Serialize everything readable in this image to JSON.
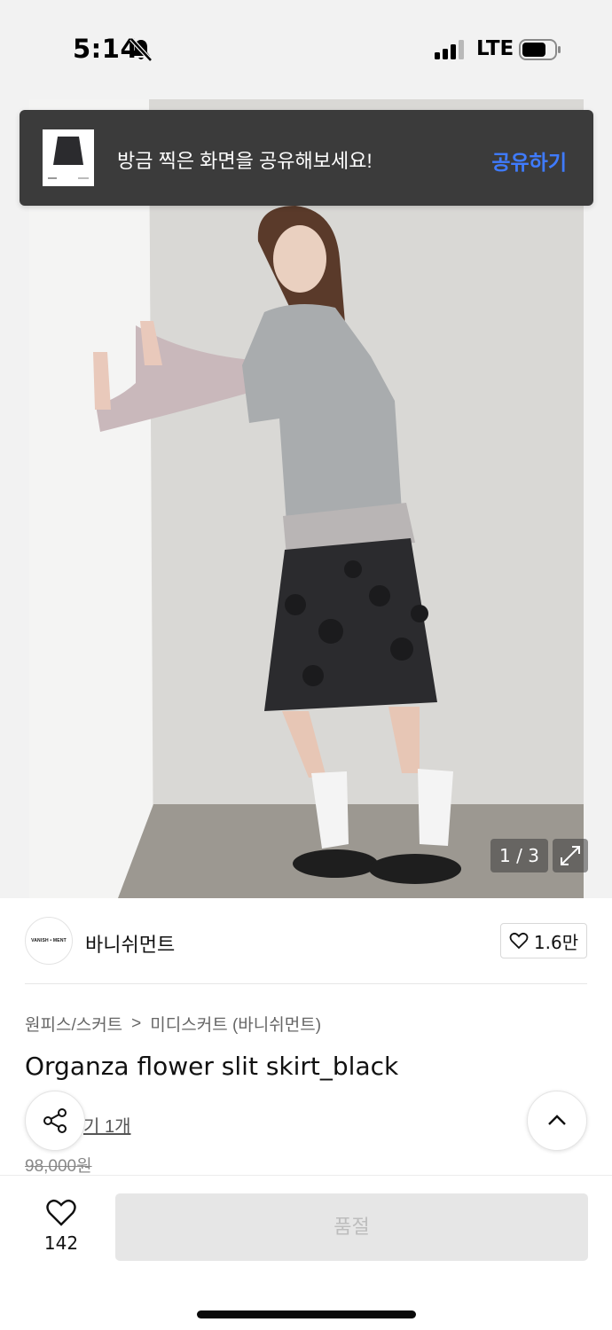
{
  "status_bar": {
    "time": "5:14",
    "network": "LTE",
    "battery_level": 0.72
  },
  "share_toast": {
    "message": "방금 찍은 화면을 공유해보세요!",
    "action": "공유하기"
  },
  "gallery": {
    "counter": "1 / 3"
  },
  "brand": {
    "logo_text": "VANISH • MENT",
    "name": "바니쉬먼트",
    "likes": "1.6만"
  },
  "product": {
    "breadcrumb": [
      "원피스/스커트",
      ">",
      "미디스커트 (바니쉬먼트)"
    ],
    "title": "Organza flower slit skirt_black",
    "review_link": "기 1개",
    "original_price": "98,000원"
  },
  "bottom_bar": {
    "wish_count": "142",
    "buy_label": "품절"
  },
  "icons": {
    "bell": "bell-slash-icon",
    "signal": "signal-icon",
    "battery": "battery-icon",
    "expand": "expand-icon",
    "heart": "heart-icon",
    "share": "share-icon",
    "up": "chevron-up-icon"
  },
  "colors": {
    "toast_bg": "#3b3b3b",
    "accent_blue": "#3f7bff",
    "soldout_bg": "#e6e6e6"
  }
}
